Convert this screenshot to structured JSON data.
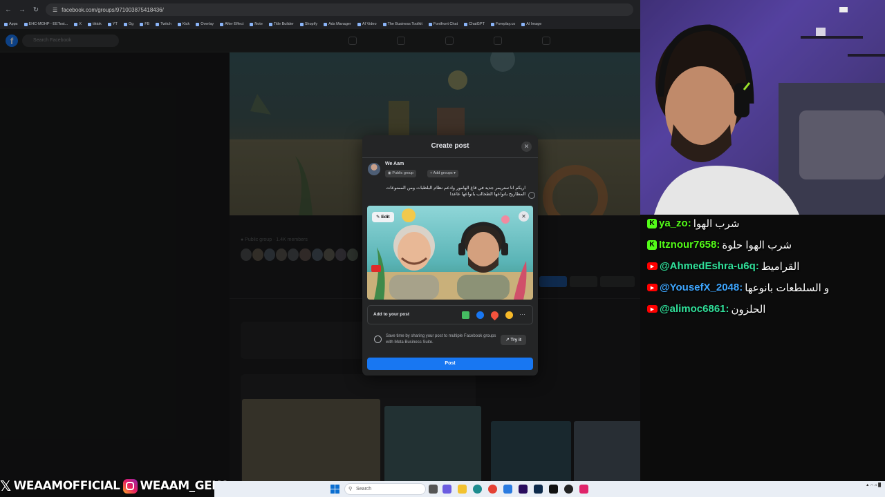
{
  "browser": {
    "url": "facebook.com/groups/971003875418436/",
    "bookmarks": [
      "Apps",
      "EHC-MOHP - EETest...",
      "X",
      "tiktok",
      "YT",
      "Gg",
      "FB",
      "Twitch",
      "Kick",
      "Overlay",
      "After Effect",
      "Note",
      "Title Builder",
      "Shopify",
      "Ads Manager",
      "AI Video",
      "The Business Toolkit",
      "Fontfront Chat",
      "ChatGPT",
      "Foreplay.co",
      "AI Image"
    ]
  },
  "facebook": {
    "search_placeholder": "Search Facebook"
  },
  "modal": {
    "title": "Create post",
    "author": "We Aam",
    "audience": "Public group",
    "add_groups": "Add groups",
    "post_text": "اريكم انا ستريمر جديد في قاع الهامور وادعم نظام البلطبات ومن الممنوعات المطاريح بانواعها الطحالب بانواعها عاعدا",
    "edit_label": "Edit",
    "add_to_post": "Add to your post",
    "mbs_text": "Save time by sharing your post to multiple Facebook groups with Meta Business Suite.",
    "try_it": "Try it",
    "post_button": "Post"
  },
  "chat": {
    "messages": [
      {
        "platform": "kick",
        "user": "ya_zo:",
        "text": "شرب الهوا",
        "color": "#53fc18"
      },
      {
        "platform": "kick",
        "user": "Itznour7658:",
        "text": "شرب الهوا حلوة",
        "color": "#53fc18"
      },
      {
        "platform": "youtube",
        "user": "@AhmedEshra-u6q:",
        "text": "القراميط",
        "color": "#30e09a"
      },
      {
        "platform": "youtube",
        "user": "@YousefX_2048:",
        "text": "و السلطعات بانوعها",
        "color": "#3ea6ff"
      },
      {
        "platform": "youtube",
        "user": "@alimoc6861:",
        "text": "الحلزون",
        "color": "#30e09a"
      }
    ]
  },
  "socials": {
    "x_handle": "WEAAMOFFICIAL",
    "ig_handle": "WEAAM_GEKA"
  },
  "taskbar": {
    "search_label": "Search"
  }
}
